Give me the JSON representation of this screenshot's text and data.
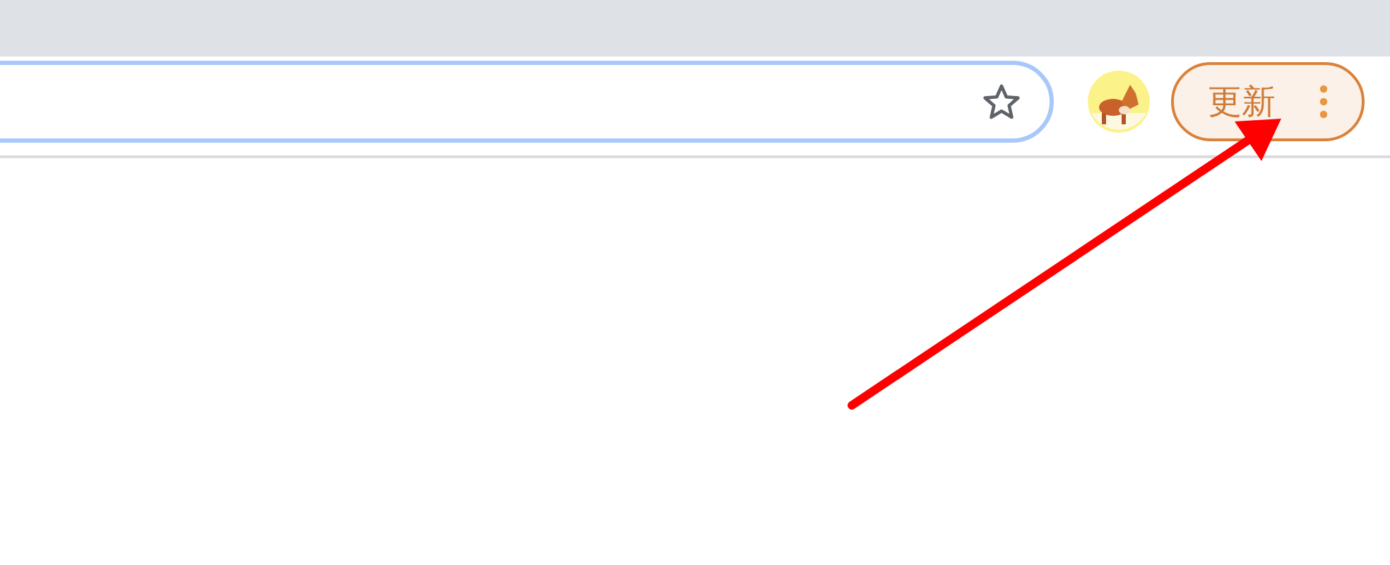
{
  "toolbar": {
    "update_button": {
      "label": "更新"
    }
  }
}
